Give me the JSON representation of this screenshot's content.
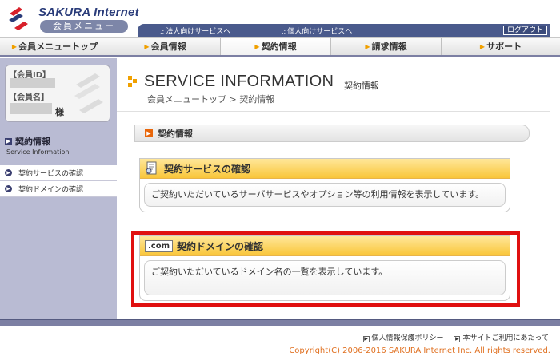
{
  "brand": {
    "name": "SAKURA Internet",
    "menu_badge": "会員メニュー",
    "colors": {
      "navy": "#2a3c7a",
      "header_bar": "#4a5a8c",
      "sidebar": "#b9bbd3",
      "accent_orange": "#e8660a",
      "highlight_red": "#e01010"
    }
  },
  "top_links": {
    "corporate": "法人向けサービスへ",
    "personal": "個人向けサービスへ",
    "logout": "ログアウト"
  },
  "nav": [
    {
      "label": "会員メニュートップ"
    },
    {
      "label": "会員情報"
    },
    {
      "label": "契約情報"
    },
    {
      "label": "請求情報"
    },
    {
      "label": "サポート"
    }
  ],
  "member": {
    "id_label": "【会員ID】",
    "name_label": "【会員名】",
    "suffix": "様"
  },
  "sidebar": {
    "title_jp": "契約情報",
    "title_en": "Service Information",
    "items": [
      {
        "label": "契約サービスの確認"
      },
      {
        "label": "契約ドメインの確認"
      }
    ]
  },
  "page": {
    "title": "SERVICE INFORMATION",
    "subtitle": "契約情報",
    "breadcrumb_home": "会員メニュートップ",
    "breadcrumb_sep": ">",
    "breadcrumb_current": "契約情報",
    "section_title": "契約情報"
  },
  "cards": [
    {
      "title": "契約サービスの確認",
      "icon": "document-icon",
      "description": "ご契約いただいているサーバサービスやオプション等の利用情報を表示しています。"
    },
    {
      "title": "契約ドメインの確認",
      "icon": ".com",
      "description": "ご契約いただいているドメイン名の一覧を表示しています。"
    }
  ],
  "footer": {
    "privacy": "個人情報保護ポリシー",
    "terms": "本サイトご利用にあたって",
    "copyright": "Copyright(C) 2006-2016 SAKURA Internet Inc. All rights reserved."
  }
}
